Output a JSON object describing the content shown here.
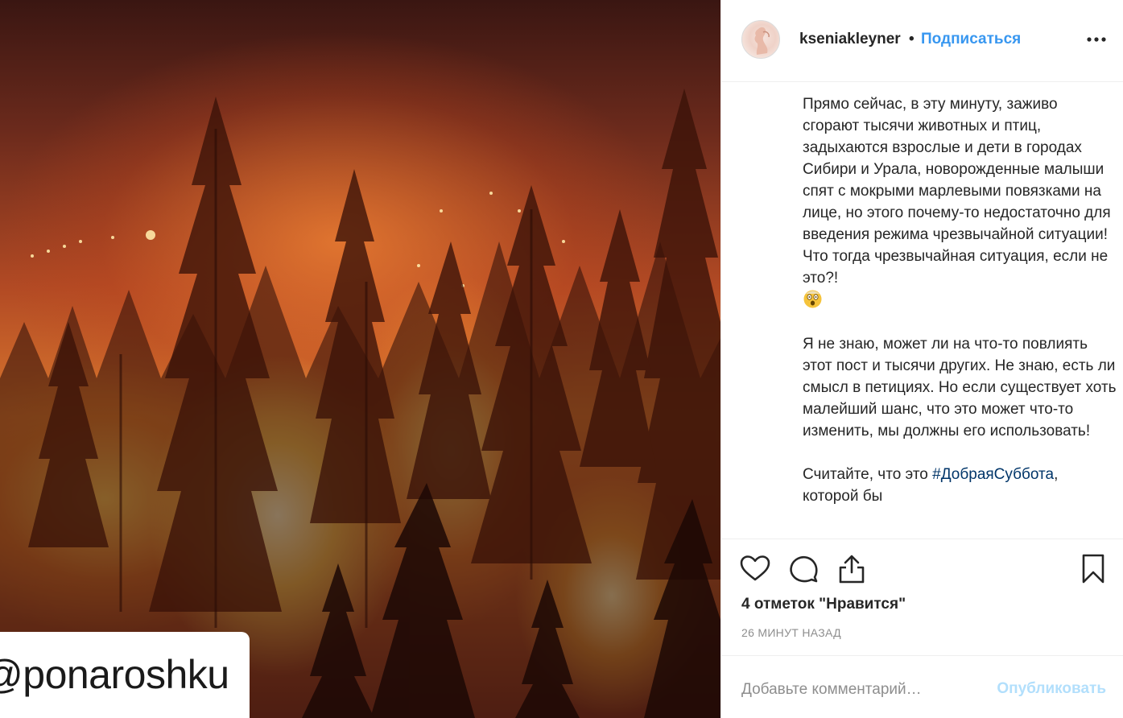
{
  "image": {
    "watermark_text": "@ponaroshku"
  },
  "header": {
    "username": "kseniakleyner",
    "separator": "•",
    "follow_label": "Подписаться",
    "more_icon": "more-horizontal-icon"
  },
  "caption": {
    "paragraph1": "Прямо сейчас, в эту минуту, заживо сгорают тысячи животных и птиц, задыхаются взрослые и дети в городах Сибири и Урала, новорожденные малыши спят с мокрыми марлевыми повязками на лице, но этого почему-то недостаточно для введения режима чрезвычайной ситуации! Что тогда чрезвычайная ситуация, если не это?!",
    "emoji": "astonished-face-emoji",
    "paragraph2": "Я не знаю, может ли на что-то повлиять этот пост и тысячи других. Не знаю, есть ли смысл в петициях. Но если существует хоть малейший шанс, что это может что-то изменить, мы должны его использовать!",
    "paragraph3_prefix": "Считайте, что это ",
    "hashtag": "#ДобраяСуббота",
    "paragraph3_suffix": ",",
    "paragraph3_cut": "которой бы"
  },
  "actions": {
    "like_icon": "heart-icon",
    "comment_icon": "comment-icon",
    "share_icon": "share-icon",
    "save_icon": "bookmark-icon"
  },
  "likes_text": "4 отметок \"Нравится\"",
  "timestamp": "26 МИНУТ НАЗАД",
  "comment": {
    "placeholder": "Добавьте комментарий…",
    "value": "",
    "publish_label": "Опубликовать"
  },
  "colors": {
    "link_blue": "#3897f0",
    "publish_disabled": "#b2dffc",
    "hashtag": "#003569",
    "muted": "#8e8e8e"
  }
}
